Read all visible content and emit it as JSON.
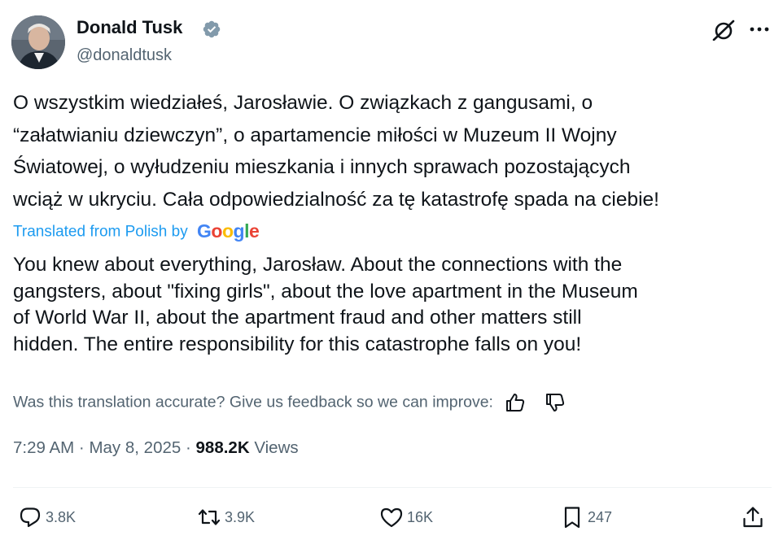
{
  "author": {
    "display_name": "Donald Tusk",
    "handle": "@donaldtusk",
    "verified_color": "#829aab"
  },
  "post": {
    "original_text": "O wszystkim wiedziałeś, Jarosławie. O związkach z gangusami, o\n“załatwianiu dziewczyn”, o apartamencie miłości w Muzeum II Wojny\nŚwiatowej, o wyłudzeniu mieszkania i innych sprawach pozostających\nwciąż w ukryciu. Cała odpowiedzialność za tę katastrofę spada na ciebie!",
    "translated_label": "Translated from Polish by",
    "google_logo": [
      "G",
      "o",
      "o",
      "g",
      "l",
      "e"
    ],
    "translation_text": "You knew about everything, Jarosław. About the connections with the\ngangsters, about \"fixing girls\", about the love apartment in the Museum\nof World War II, about the apartment fraud and other matters still\nhidden. The entire responsibility for this catastrophe falls on you!",
    "feedback_prompt": "Was this translation accurate? Give us feedback so we can improve:",
    "time": "7:29 AM",
    "separator": "·",
    "date": "May 8, 2025",
    "views_count": "988.2K",
    "views_label": "Views"
  },
  "actions": {
    "replies": "3.8K",
    "reposts": "3.9K",
    "likes": "16K",
    "bookmarks": "247"
  },
  "colors": {
    "link": "#1d9bf0",
    "secondary_text": "#536471",
    "primary_text": "#0f1419",
    "google_blue": "#4285f4",
    "google_red": "#ea4335",
    "google_yellow": "#fbbc05",
    "google_green": "#34a853"
  },
  "icons": [
    "verified-badge-icon",
    "grok-icon",
    "more-icon",
    "thumbs-up-icon",
    "thumbs-down-icon",
    "reply-icon",
    "repost-icon",
    "like-icon",
    "bookmark-icon",
    "share-icon"
  ]
}
